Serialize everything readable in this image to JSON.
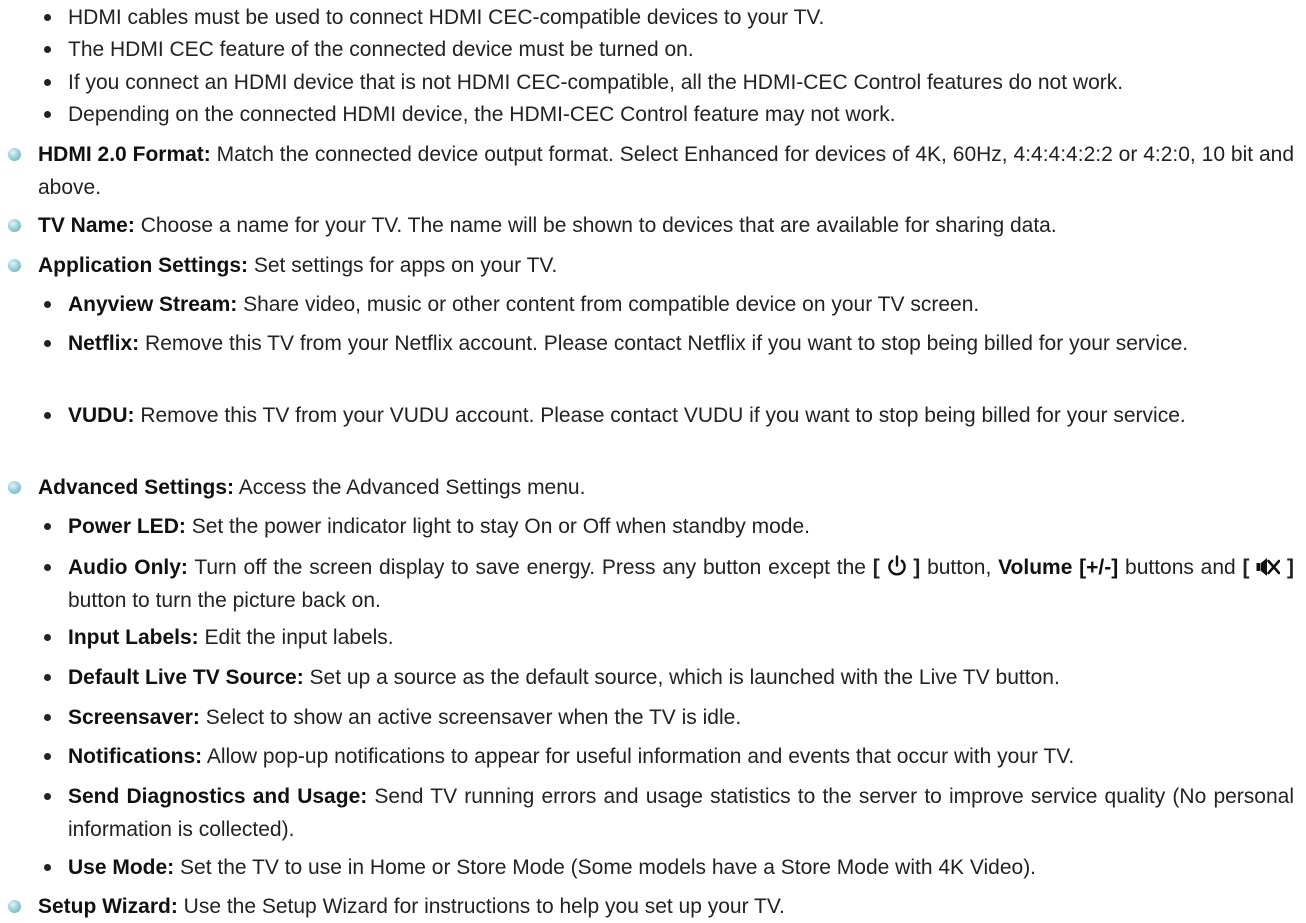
{
  "hdmi_notes": [
    "HDMI cables must be used to connect HDMI CEC-compatible devices to your TV.",
    "The HDMI CEC feature of the connected device must be turned on.",
    "If you connect an HDMI device that is not HDMI CEC-compatible, all the HDMI-CEC Control features do not work.",
    "Depending on the connected HDMI device, the HDMI-CEC Control feature may not work."
  ],
  "hdmi_format": {
    "title": "HDMI 2.0 Format:",
    "text": " Match the connected device output format. Select Enhanced for devices of 4K, 60Hz, 4:4:4:4:2:2 or 4:2:0, 10 bit and above."
  },
  "tv_name": {
    "title": "TV Name:",
    "text": " Choose a name for your TV. The name will be shown to devices that are available for sharing data."
  },
  "app_settings": {
    "title": "Application Settings:",
    "text": " Set settings for apps on your TV.",
    "items": [
      {
        "title": "Anyview Stream:",
        "text": " Share video, music or other content from compatible device on your TV screen."
      },
      {
        "title": "Netflix:",
        "text": " Remove this TV from your Netflix account. Please contact Netflix if you want to stop being billed for your service."
      },
      {
        "title": "VUDU:",
        "text": " Remove this TV from your VUDU account. Please contact VUDU if you want to stop being billed for your service."
      }
    ]
  },
  "advanced_settings": {
    "title": "Advanced Settings:",
    "text": " Access the Advanced Settings menu.",
    "power_led": {
      "title": "Power LED:",
      "text": " Set the power indicator light to stay On or Off when standby mode."
    },
    "audio_only": {
      "title": "Audio Only:",
      "text_1": " Turn off the screen display to save energy. Press any button except the ",
      "text_2": " button, ",
      "volume": "Volume [+/-]",
      "text_3": " buttons and ",
      "text_4": " button to turn the picture back on.",
      "power_icon": "power-icon",
      "mute_icon": "mute-icon"
    },
    "items": [
      {
        "title": "Input Labels:",
        "text": " Edit the input labels."
      },
      {
        "title": "Default Live TV Source:",
        "text": " Set up a source as the default source, which is launched with the Live TV button."
      },
      {
        "title": "Screensaver:",
        "text": " Select to show an active screensaver when the TV is idle."
      },
      {
        "title": "Notifications:",
        "text": " Allow pop-up notifications to appear for useful information and events that occur with your TV."
      },
      {
        "title": "Send Diagnostics and Usage:",
        "text": " Send TV running errors and usage statistics to the server to improve service quality (No personal information is collected)."
      },
      {
        "title": "Use Mode:",
        "text": " Set the TV to use in Home or Store Mode (Some models have a Store Mode with 4K Video)."
      }
    ]
  },
  "setup_wizard": {
    "title": "Setup Wizard:",
    "text": " Use the Setup Wizard for instructions to help you set up your TV."
  },
  "colors": {
    "bullet_accent": "#62a9b7",
    "text": "#222222"
  }
}
